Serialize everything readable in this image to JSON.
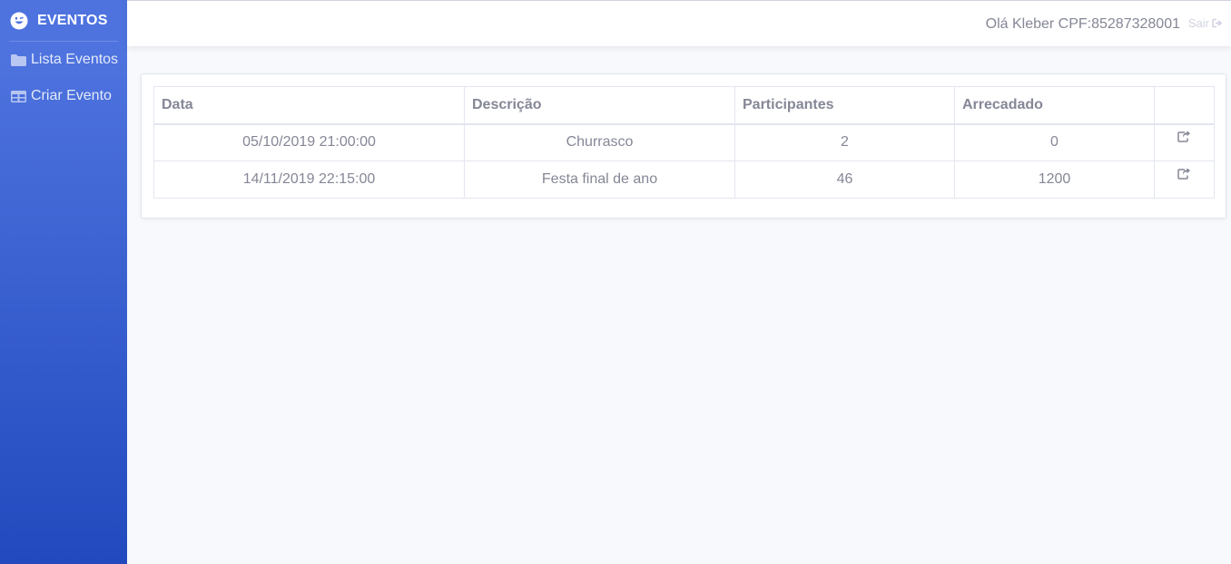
{
  "sidebar": {
    "brand": "EVENTOS",
    "brand_icon": "smile-icon",
    "items": [
      {
        "label": "Lista Eventos",
        "icon": "folder-icon"
      },
      {
        "label": "Criar Evento",
        "icon": "table-icon"
      }
    ],
    "colors": {
      "gradient_top": "#4e73df",
      "gradient_bottom": "#224abe"
    }
  },
  "topbar": {
    "greeting": "Olá Kleber CPF:85287328001",
    "logout_label": "Sair",
    "logout_icon": "sign-out-icon"
  },
  "table": {
    "headers": [
      "Data",
      "Descrição",
      "Participantes",
      "Arrecadado",
      ""
    ],
    "rows": [
      {
        "data": "05/10/2019 21:00:00",
        "descricao": "Churrasco",
        "participantes": "2",
        "arrecadado": "0",
        "action_icon": "share-icon"
      },
      {
        "data": "14/11/2019 22:15:00",
        "descricao": "Festa final de ano",
        "participantes": "46",
        "arrecadado": "1200",
        "action_icon": "share-icon"
      }
    ]
  }
}
